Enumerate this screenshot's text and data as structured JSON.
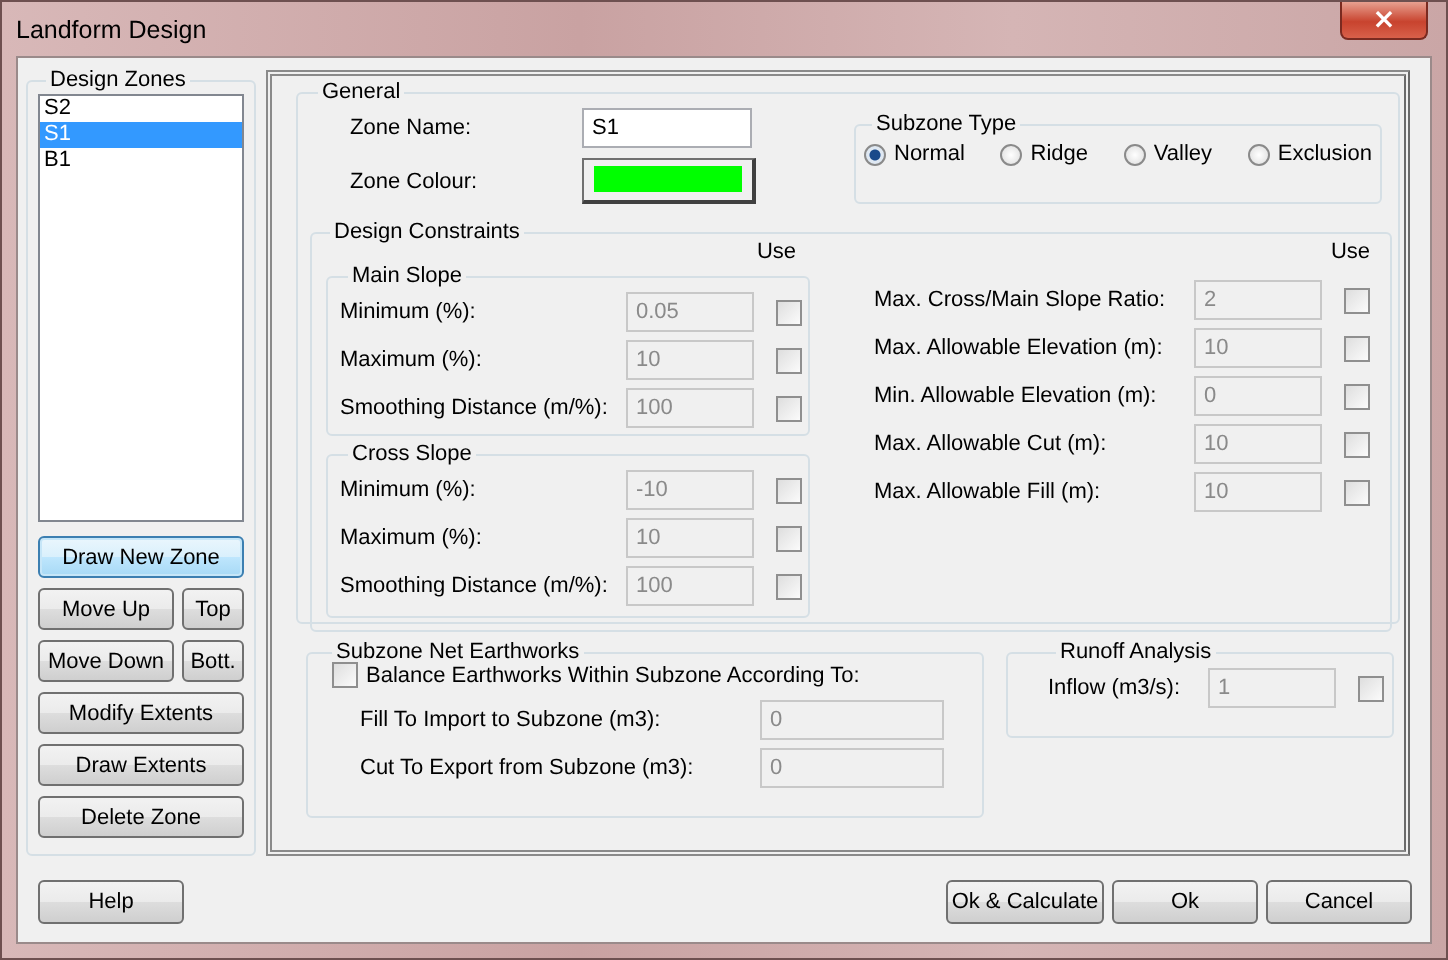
{
  "window": {
    "title": "Landform Design",
    "close": "×"
  },
  "design_zones": {
    "title": "Design Zones",
    "items": [
      {
        "label": "S2",
        "selected": false
      },
      {
        "label": "S1",
        "selected": true
      },
      {
        "label": "B1",
        "selected": false
      }
    ],
    "buttons": [
      [
        {
          "label": "Draw New Zone",
          "focused": true
        }
      ],
      [
        {
          "label": "Move Up",
          "focused": false
        },
        {
          "label": "Top",
          "focused": false
        }
      ],
      [
        {
          "label": "Move Down",
          "focused": false
        },
        {
          "label": "Bott.",
          "focused": false
        }
      ],
      [
        {
          "label": "Modify Extents",
          "focused": false
        }
      ],
      [
        {
          "label": "Draw Extents",
          "focused": false
        }
      ],
      [
        {
          "label": "Delete Zone",
          "focused": false
        }
      ]
    ]
  },
  "general": {
    "title": "General",
    "zone_name_label": "Zone Name:",
    "zone_name": "S1",
    "zone_colour_label": "Zone Colour:",
    "subzone_type": {
      "title": "Subzone Type",
      "options": [
        {
          "label": "Normal",
          "selected": true
        },
        {
          "label": "Ridge",
          "selected": false
        },
        {
          "label": "Valley",
          "selected": false
        },
        {
          "label": "Exclusion",
          "selected": false
        }
      ]
    },
    "design_constraints": {
      "title": "Design Constraints",
      "use_label_left": "Use",
      "use_label_right": "Use",
      "groups": [
        {
          "title": "Main Slope",
          "rows": [
            {
              "label": "Minimum (%):",
              "value": "0.05",
              "disabled": true,
              "checked": false
            },
            {
              "label": "Maximum (%):",
              "value": "10",
              "disabled": true,
              "checked": false
            },
            {
              "label": "Smoothing Distance (m/%):",
              "value": "100",
              "disabled": true,
              "checked": false
            }
          ]
        },
        {
          "title": "Cross Slope",
          "rows": [
            {
              "label": "Minimum (%):",
              "value": "-10",
              "disabled": true,
              "checked": false
            },
            {
              "label": "Maximum (%):",
              "value": "10",
              "disabled": true,
              "checked": false
            },
            {
              "label": "Smoothing Distance (m/%):",
              "value": "100",
              "disabled": true,
              "checked": false
            }
          ]
        }
      ],
      "limits": [
        {
          "label": "Max. Cross/Main Slope Ratio:",
          "value": "2",
          "disabled": true,
          "checked": false
        },
        {
          "label": "Max. Allowable Elevation (m):",
          "value": "10",
          "disabled": true,
          "checked": false
        },
        {
          "label": "Min. Allowable Elevation (m):",
          "value": "0",
          "disabled": true,
          "checked": false
        },
        {
          "label": "Max. Allowable Cut (m):",
          "value": "10",
          "disabled": true,
          "checked": false
        },
        {
          "label": "Max. Allowable Fill (m):",
          "value": "10",
          "disabled": true,
          "checked": false
        }
      ]
    }
  },
  "subzone_net_earthworks": {
    "title": "Subzone Net Earthworks",
    "balance": {
      "label": "Balance Earthworks Within Subzone According To:",
      "checked": false
    },
    "rows": [
      {
        "label": "Fill To Import to Subzone (m3):",
        "value": "0",
        "disabled": true
      },
      {
        "label": "Cut To Export from Subzone (m3):",
        "value": "0",
        "disabled": true
      }
    ]
  },
  "runoff_analysis": {
    "title": "Runoff Analysis",
    "rows": [
      {
        "label": "Inflow (m3/s):",
        "value": "1",
        "disabled": true,
        "checked": false
      }
    ]
  },
  "footer": {
    "help": "Help",
    "buttons": [
      "Ok & Calculate",
      "Ok",
      "Cancel"
    ]
  }
}
